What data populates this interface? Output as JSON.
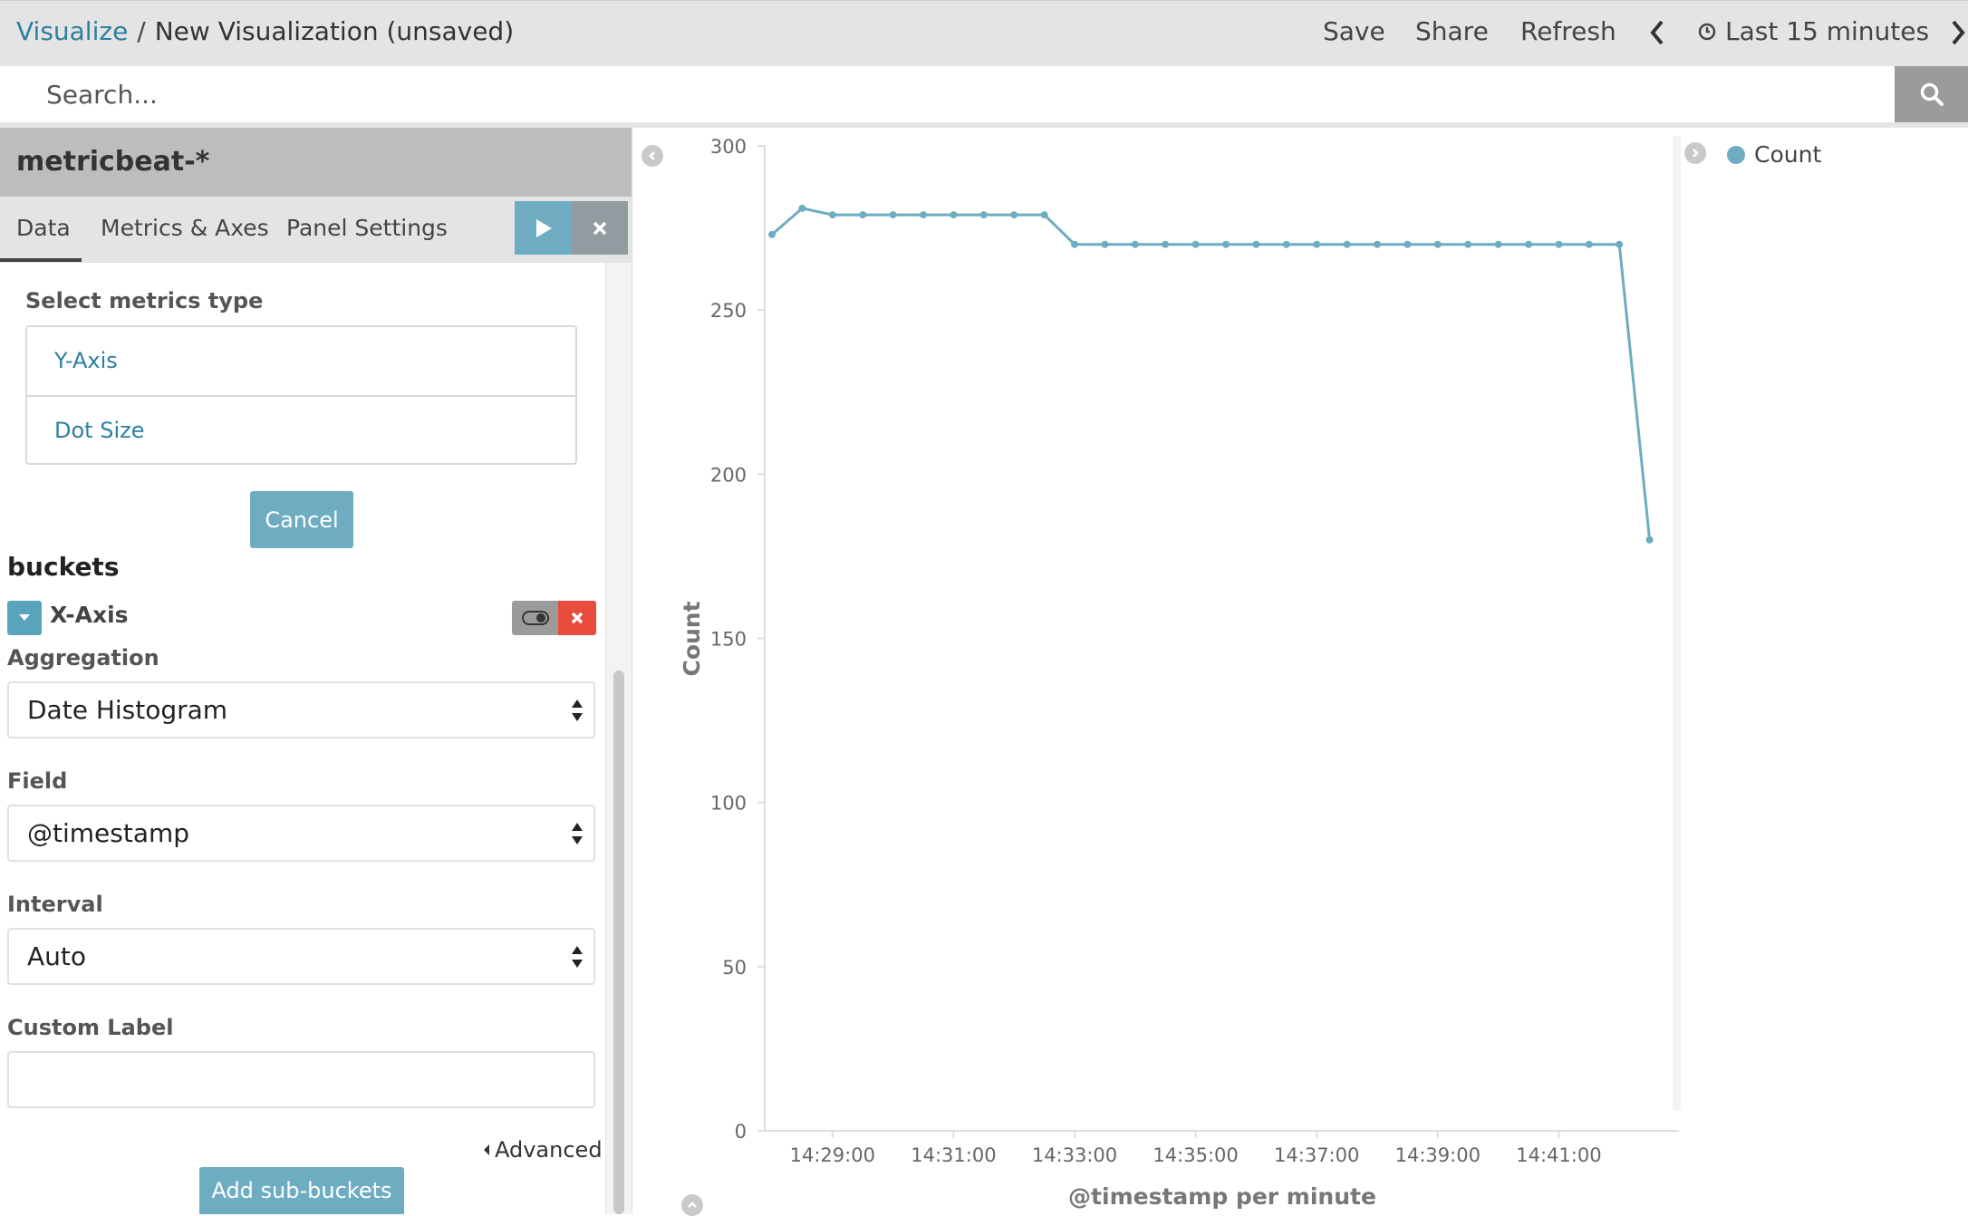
{
  "breadcrumb": {
    "root": "Visualize",
    "separator": "/",
    "current": "New Visualization (unsaved)"
  },
  "top_actions": {
    "save": "Save",
    "share": "Share",
    "refresh": "Refresh",
    "time_range": "Last 15 minutes"
  },
  "search": {
    "placeholder": "Search..."
  },
  "sidebar": {
    "index_pattern": "metricbeat-*",
    "tabs": [
      {
        "label": "Data"
      },
      {
        "label": "Metrics & Axes"
      },
      {
        "label": "Panel Settings"
      }
    ],
    "select_metrics_title": "Select metrics type",
    "metric_types": [
      "Y-Axis",
      "Dot Size"
    ],
    "cancel_label": "Cancel",
    "buckets_title": "buckets",
    "bucket_label": "X-Axis",
    "aggregation_label": "Aggregation",
    "aggregation_value": "Date Histogram",
    "field_label": "Field",
    "field_value": "@timestamp",
    "interval_label": "Interval",
    "interval_value": "Auto",
    "custom_label_title": "Custom Label",
    "custom_label_value": "",
    "advanced_label": "Advanced",
    "add_sub_buckets_label": "Add sub-buckets"
  },
  "colors": {
    "accent": "#6eadc1",
    "link": "#2d7f9f",
    "danger": "#e74c3c",
    "topbar": "#e4e4e4"
  },
  "chart_data": {
    "type": "line",
    "ylabel": "Count",
    "xlabel": "@timestamp per minute",
    "ylim": [
      0,
      300
    ],
    "yticks": [
      0,
      50,
      100,
      150,
      200,
      250,
      300
    ],
    "xticks": [
      "14:29:00",
      "14:31:00",
      "14:33:00",
      "14:35:00",
      "14:37:00",
      "14:39:00",
      "14:41:00"
    ],
    "x_start": "14:28:00",
    "x_step_seconds": 30,
    "legend": [
      {
        "name": "Count",
        "color": "#6eadc1"
      }
    ],
    "series": [
      {
        "name": "Count",
        "values": [
          273,
          281,
          279,
          279,
          279,
          279,
          279,
          279,
          279,
          279,
          270,
          270,
          270,
          270,
          270,
          270,
          270,
          270,
          270,
          270,
          270,
          270,
          270,
          270,
          270,
          270,
          270,
          270,
          270,
          180
        ]
      }
    ]
  }
}
